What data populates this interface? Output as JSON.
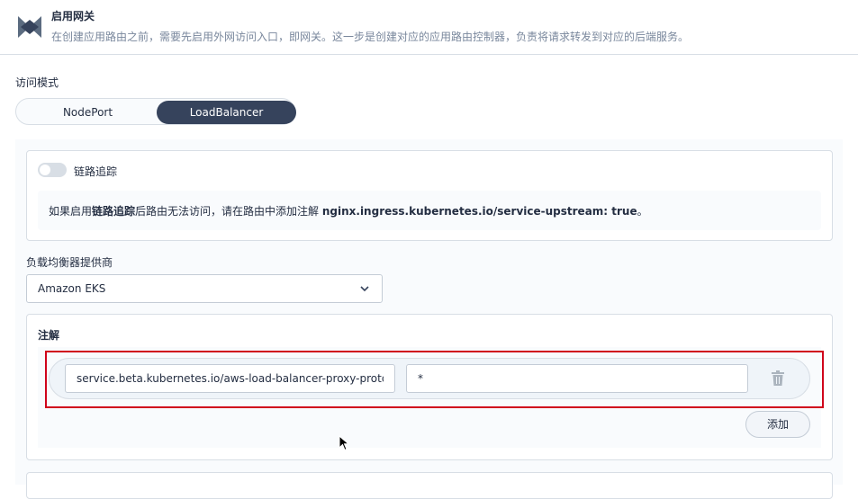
{
  "header": {
    "title": "启用网关",
    "description": "在创建应用路由之前，需要先启用外网访问入口，即网关。这一步是创建对应的应用路由控制器，负责将请求转发到对应的后端服务。"
  },
  "access_mode": {
    "label": "访问模式",
    "options": [
      "NodePort",
      "LoadBalancer"
    ],
    "selected": "LoadBalancer"
  },
  "tracing": {
    "label": "链路追踪",
    "enabled": false,
    "note_prefix": "如果启用",
    "note_bold": "链路追踪",
    "note_middle": "后路由无法访问，请在路由中添加注解 ",
    "note_code": "nginx.ingress.kubernetes.io/service-upstream: true",
    "note_suffix": "。"
  },
  "provider": {
    "label": "负载均衡器提供商",
    "value": "Amazon EKS"
  },
  "annotations": {
    "title": "注解",
    "rows": [
      {
        "key": "service.beta.kubernetes.io/aws-load-balancer-proxy-protocol",
        "value": "*"
      }
    ],
    "add_label": "添加"
  },
  "icons": {
    "logo": "gateway-logo-icon",
    "select": "chevron-down-icon",
    "delete": "trash-icon",
    "pointer": "mouse-cursor-icon"
  },
  "colors": {
    "primary_dark": "#36435c",
    "highlight_border": "#d0021b",
    "muted_text": "#79879c"
  }
}
